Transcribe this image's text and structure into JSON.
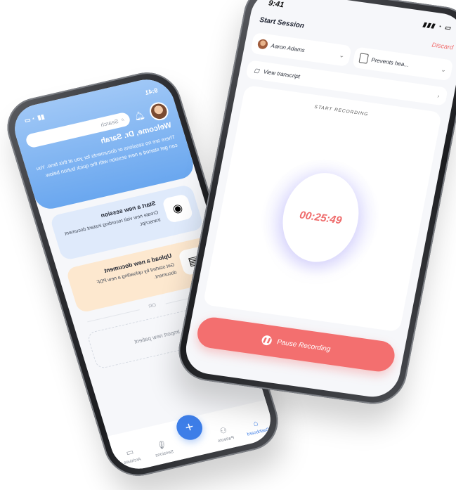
{
  "left_phone": {
    "status_time": "9:41",
    "search_placeholder": "Search",
    "welcome": "Welcome, Dr. Sarah",
    "intro": "There are no sessions or documents for you at this time. You can get started a new session with the quick button below.",
    "cards": [
      {
        "title": "Start a new session",
        "desc": "Create new visit recording instant document transcript.",
        "icon": "waveform-icon"
      },
      {
        "title": "Upload a new document",
        "desc": "Get started by uploading a new PDF document.",
        "icon": "document-icon"
      }
    ],
    "or_label": "OR",
    "import_label": "Import new patient",
    "nav": [
      {
        "label": "Dashboard",
        "icon": "home-icon",
        "active": true
      },
      {
        "label": "Patients",
        "icon": "people-icon"
      },
      {
        "label": "Sessions",
        "icon": "mic-icon"
      },
      {
        "label": "Archives",
        "icon": "archive-icon"
      }
    ],
    "fab_symbol": "+"
  },
  "right_phone": {
    "status_time": "9:41",
    "title": "Start Session",
    "discard": "Discard",
    "patient_chip": "Aaron Adams",
    "note_chip": "Prevents hea...",
    "transcript_label": "View transcript",
    "start_recording": "START RECORDING",
    "timer": "00:25:49",
    "pause_label": "Pause Recording"
  },
  "colors": {
    "accent_blue": "#3d7ee8",
    "accent_red": "#f36f6f",
    "card_blue": "#dfeafb",
    "card_orange": "#fde8cf"
  }
}
